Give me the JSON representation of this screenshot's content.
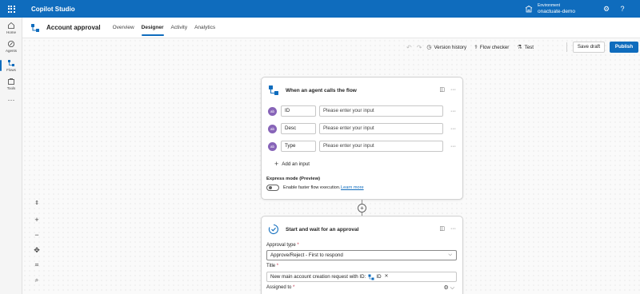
{
  "app": {
    "name": "Copilot Studio"
  },
  "environment": {
    "label": "Environment",
    "name": "onactuate-demo"
  },
  "nav": [
    {
      "label": "Home",
      "icon": "home-icon"
    },
    {
      "label": "Agents",
      "icon": "agents-icon"
    },
    {
      "label": "Flows",
      "icon": "flows-icon"
    },
    {
      "label": "Tools",
      "icon": "tools-icon"
    }
  ],
  "header": {
    "title": "Account approval",
    "tabs": [
      "Overview",
      "Designer",
      "Activity",
      "Analytics"
    ],
    "active_tab": "Designer"
  },
  "toolbar": {
    "version_history": "Version history",
    "flow_checker": "Flow checker",
    "test": "Test",
    "save_draft": "Save draft",
    "publish": "Publish"
  },
  "trigger_card": {
    "title": "When an agent calls the flow",
    "params": [
      {
        "badge": "ab",
        "name": "ID",
        "placeholder": "Please enter your input"
      },
      {
        "badge": "ab",
        "name": "Desc",
        "placeholder": "Please enter your input"
      },
      {
        "badge": "ab",
        "name": "Type",
        "placeholder": "Please enter your input"
      }
    ],
    "add_input": "Add an input",
    "express_mode_title": "Express mode (Preview)",
    "express_mode_text": "Enable faster flow execution.",
    "learn_more": "Learn more"
  },
  "approval_card": {
    "title": "Start and wait for an approval",
    "approval_type_label": "Approval type",
    "approval_type_value": "Approve/Reject - First to respond",
    "title_label": "Title",
    "title_value": "New main account creation request with ID:",
    "title_token": "ID",
    "assigned_to_label": "Assigned to"
  },
  "colors": {
    "accent": "#0f6cbd",
    "badge": "#8764b8"
  }
}
